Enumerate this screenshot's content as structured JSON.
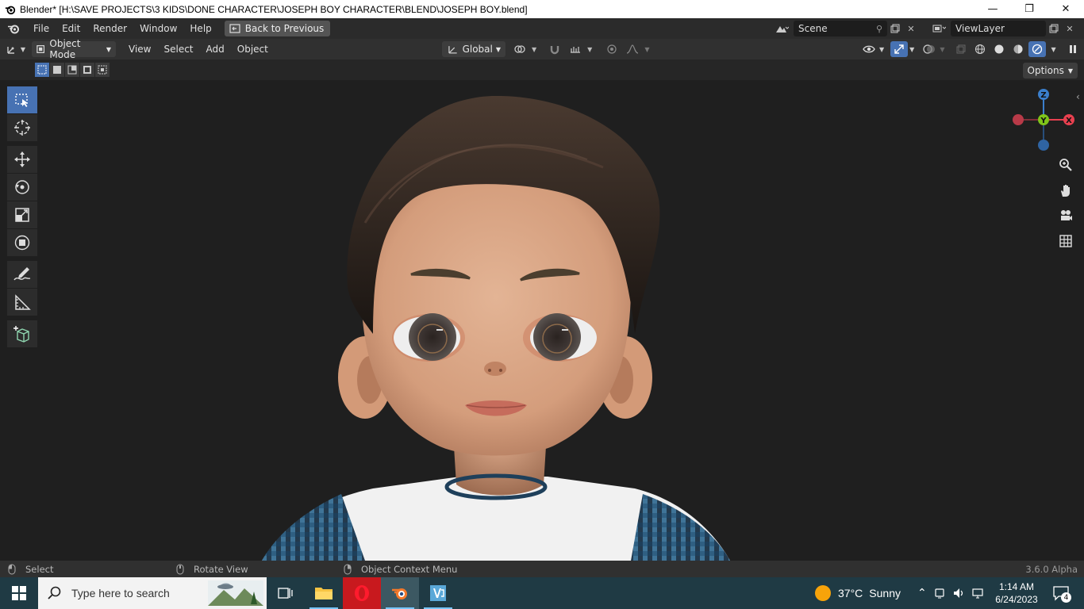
{
  "window": {
    "title": "Blender* [H:\\SAVE PROJECTS\\3 KIDS\\DONE CHARACTER\\JOSEPH BOY CHARACTER\\BLEND\\JOSEPH BOY.blend]",
    "minimize": "—",
    "maximize": "❐",
    "close": "✕"
  },
  "menubar": {
    "items": [
      "File",
      "Edit",
      "Render",
      "Window",
      "Help"
    ],
    "back_button": "Back to Previous",
    "scene": "Scene",
    "view_layer": "ViewLayer"
  },
  "viewport_header": {
    "mode": "Object Mode",
    "menus": [
      "View",
      "Select",
      "Add",
      "Object"
    ],
    "orientation": "Global"
  },
  "tool_settings": {
    "options": "Options"
  },
  "gizmo": {
    "axes": [
      "Z",
      "Y",
      "X"
    ]
  },
  "statusbar": {
    "select": "Select",
    "rotate": "Rotate View",
    "context_menu": "Object Context Menu",
    "version": "3.6.0 Alpha"
  },
  "taskbar": {
    "search_placeholder": "Type here to search",
    "weather_temp": "37°C",
    "weather_desc": "Sunny",
    "time": "1:14 AM",
    "date": "6/24/2023",
    "notification_count": "4"
  },
  "colors": {
    "accent": "#4772b3",
    "viewport_bg": "#1f1f1f",
    "taskbar_bg": "#1f3a44",
    "axis_x": "#e8404f",
    "axis_y": "#7fc41a",
    "axis_z": "#3b7fcc"
  }
}
